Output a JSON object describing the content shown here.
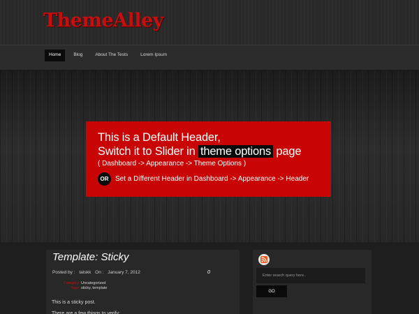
{
  "site": {
    "logo": "ThemeAlley"
  },
  "nav": {
    "items": [
      {
        "label": "Home",
        "active": true
      },
      {
        "label": "Blog",
        "active": false
      },
      {
        "label": "About The Tests",
        "active": false
      },
      {
        "label": "Lorem Ipsum",
        "active": false
      }
    ]
  },
  "banner": {
    "line1": "This is a Default Header,",
    "line2_prefix": "Switch it to Slider in",
    "line2_highlight": "theme options",
    "line2_suffix": "page",
    "subline": "( Dashboard -> Appearance -> Theme Options )",
    "or_badge": "OR",
    "alt_text": "Set a Different Header in Dashboard -> Appearance -> Header"
  },
  "post": {
    "title": "Template: Sticky",
    "posted_by_label": "Posted by :",
    "author": "tatskk",
    "on_label": "On :",
    "date": "January 7, 2012",
    "comment_count": "0",
    "category_label": "Category",
    "category_value": "Uncategorized",
    "tags_label": "Tags",
    "tags_value": "sticky, template",
    "body_line1": "This is a sticky post.",
    "body_line2": "There are a few things to verify:"
  },
  "sidebar": {
    "rss_icon": "rss-icon",
    "search_placeholder": "Enter search query here..",
    "go_label": "GO"
  },
  "colors": {
    "brand_red": "#c40f10",
    "banner_red": "#c80404",
    "background": "#1f1f1f"
  }
}
